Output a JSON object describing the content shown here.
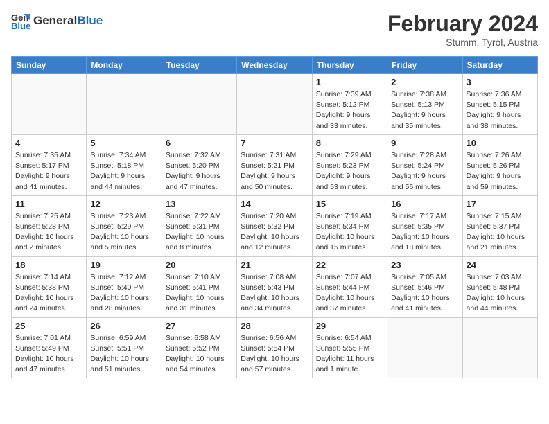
{
  "header": {
    "logo_line1": "General",
    "logo_line2": "Blue",
    "month": "February 2024",
    "location": "Stumm, Tyrol, Austria"
  },
  "weekdays": [
    "Sunday",
    "Monday",
    "Tuesday",
    "Wednesday",
    "Thursday",
    "Friday",
    "Saturday"
  ],
  "weeks": [
    [
      {
        "day": "",
        "detail": ""
      },
      {
        "day": "",
        "detail": ""
      },
      {
        "day": "",
        "detail": ""
      },
      {
        "day": "",
        "detail": ""
      },
      {
        "day": "1",
        "detail": "Sunrise: 7:39 AM\nSunset: 5:12 PM\nDaylight: 9 hours\nand 33 minutes."
      },
      {
        "day": "2",
        "detail": "Sunrise: 7:38 AM\nSunset: 5:13 PM\nDaylight: 9 hours\nand 35 minutes."
      },
      {
        "day": "3",
        "detail": "Sunrise: 7:36 AM\nSunset: 5:15 PM\nDaylight: 9 hours\nand 38 minutes."
      }
    ],
    [
      {
        "day": "4",
        "detail": "Sunrise: 7:35 AM\nSunset: 5:17 PM\nDaylight: 9 hours\nand 41 minutes."
      },
      {
        "day": "5",
        "detail": "Sunrise: 7:34 AM\nSunset: 5:18 PM\nDaylight: 9 hours\nand 44 minutes."
      },
      {
        "day": "6",
        "detail": "Sunrise: 7:32 AM\nSunset: 5:20 PM\nDaylight: 9 hours\nand 47 minutes."
      },
      {
        "day": "7",
        "detail": "Sunrise: 7:31 AM\nSunset: 5:21 PM\nDaylight: 9 hours\nand 50 minutes."
      },
      {
        "day": "8",
        "detail": "Sunrise: 7:29 AM\nSunset: 5:23 PM\nDaylight: 9 hours\nand 53 minutes."
      },
      {
        "day": "9",
        "detail": "Sunrise: 7:28 AM\nSunset: 5:24 PM\nDaylight: 9 hours\nand 56 minutes."
      },
      {
        "day": "10",
        "detail": "Sunrise: 7:26 AM\nSunset: 5:26 PM\nDaylight: 9 hours\nand 59 minutes."
      }
    ],
    [
      {
        "day": "11",
        "detail": "Sunrise: 7:25 AM\nSunset: 5:28 PM\nDaylight: 10 hours\nand 2 minutes."
      },
      {
        "day": "12",
        "detail": "Sunrise: 7:23 AM\nSunset: 5:29 PM\nDaylight: 10 hours\nand 5 minutes."
      },
      {
        "day": "13",
        "detail": "Sunrise: 7:22 AM\nSunset: 5:31 PM\nDaylight: 10 hours\nand 8 minutes."
      },
      {
        "day": "14",
        "detail": "Sunrise: 7:20 AM\nSunset: 5:32 PM\nDaylight: 10 hours\nand 12 minutes."
      },
      {
        "day": "15",
        "detail": "Sunrise: 7:19 AM\nSunset: 5:34 PM\nDaylight: 10 hours\nand 15 minutes."
      },
      {
        "day": "16",
        "detail": "Sunrise: 7:17 AM\nSunset: 5:35 PM\nDaylight: 10 hours\nand 18 minutes."
      },
      {
        "day": "17",
        "detail": "Sunrise: 7:15 AM\nSunset: 5:37 PM\nDaylight: 10 hours\nand 21 minutes."
      }
    ],
    [
      {
        "day": "18",
        "detail": "Sunrise: 7:14 AM\nSunset: 5:38 PM\nDaylight: 10 hours\nand 24 minutes."
      },
      {
        "day": "19",
        "detail": "Sunrise: 7:12 AM\nSunset: 5:40 PM\nDaylight: 10 hours\nand 28 minutes."
      },
      {
        "day": "20",
        "detail": "Sunrise: 7:10 AM\nSunset: 5:41 PM\nDaylight: 10 hours\nand 31 minutes."
      },
      {
        "day": "21",
        "detail": "Sunrise: 7:08 AM\nSunset: 5:43 PM\nDaylight: 10 hours\nand 34 minutes."
      },
      {
        "day": "22",
        "detail": "Sunrise: 7:07 AM\nSunset: 5:44 PM\nDaylight: 10 hours\nand 37 minutes."
      },
      {
        "day": "23",
        "detail": "Sunrise: 7:05 AM\nSunset: 5:46 PM\nDaylight: 10 hours\nand 41 minutes."
      },
      {
        "day": "24",
        "detail": "Sunrise: 7:03 AM\nSunset: 5:48 PM\nDaylight: 10 hours\nand 44 minutes."
      }
    ],
    [
      {
        "day": "25",
        "detail": "Sunrise: 7:01 AM\nSunset: 5:49 PM\nDaylight: 10 hours\nand 47 minutes."
      },
      {
        "day": "26",
        "detail": "Sunrise: 6:59 AM\nSunset: 5:51 PM\nDaylight: 10 hours\nand 51 minutes."
      },
      {
        "day": "27",
        "detail": "Sunrise: 6:58 AM\nSunset: 5:52 PM\nDaylight: 10 hours\nand 54 minutes."
      },
      {
        "day": "28",
        "detail": "Sunrise: 6:56 AM\nSunset: 5:54 PM\nDaylight: 10 hours\nand 57 minutes."
      },
      {
        "day": "29",
        "detail": "Sunrise: 6:54 AM\nSunset: 5:55 PM\nDaylight: 11 hours\nand 1 minute."
      },
      {
        "day": "",
        "detail": ""
      },
      {
        "day": "",
        "detail": ""
      }
    ]
  ]
}
